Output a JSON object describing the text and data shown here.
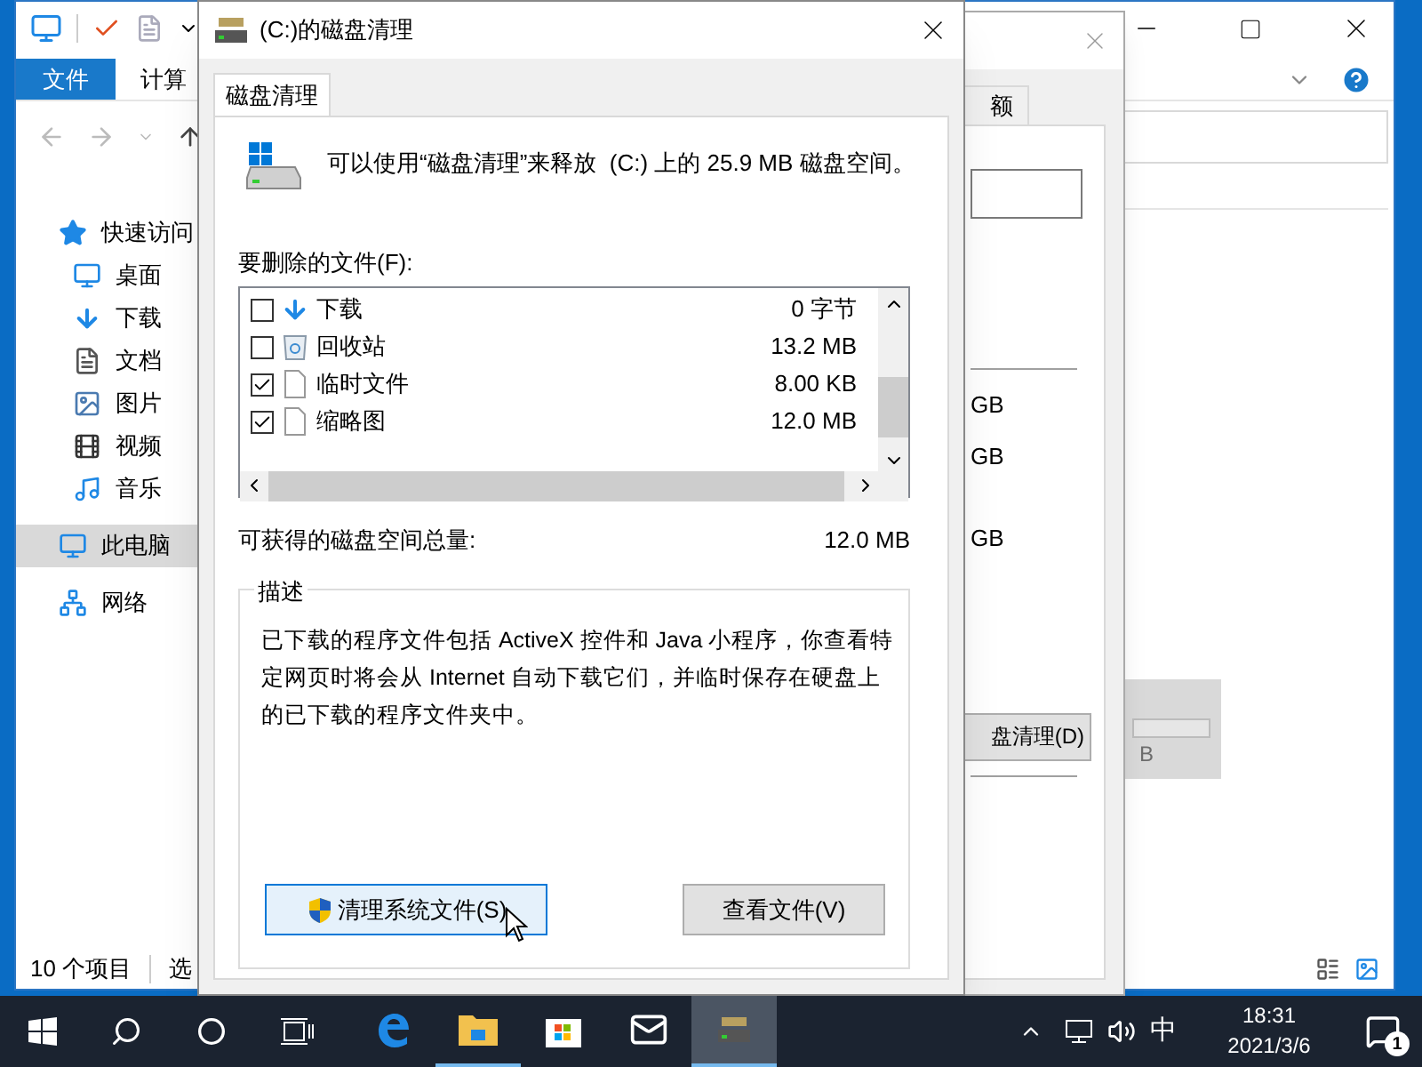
{
  "explorer": {
    "ribbon_tabs": [
      {
        "label": "文件",
        "selected": true
      },
      {
        "label": "计算",
        "selected": false
      }
    ],
    "sidebar": {
      "items": [
        {
          "label": "快速访问",
          "selected": false,
          "children": [
            {
              "label": "桌面",
              "selected": false
            },
            {
              "label": "下载",
              "selected": false
            },
            {
              "label": "文档",
              "selected": false
            },
            {
              "label": "图片",
              "selected": false
            },
            {
              "label": "视频",
              "selected": false
            },
            {
              "label": "音乐",
              "selected": false
            }
          ]
        },
        {
          "label": "此电脑",
          "selected": true
        },
        {
          "label": "网络",
          "selected": false
        }
      ]
    },
    "status_bar": {
      "item_count": "10 个项目",
      "selection": "选"
    }
  },
  "properties_dialog": {
    "tab": "额",
    "sizes": [
      "GB",
      "GB",
      "GB"
    ],
    "button": "盘清理(D)",
    "drive_size": "B"
  },
  "cleanup_dialog": {
    "title": "(C:)的磁盘清理",
    "tabs": [
      {
        "label": "磁盘清理",
        "selected": true
      }
    ],
    "intro": "可以使用“磁盘清理”来释放  (C:) 上的 25.9 MB 磁盘空间。",
    "files_label": "要删除的文件(F):",
    "files": [
      {
        "checked": false,
        "label": "下载",
        "size": "0 字节"
      },
      {
        "checked": false,
        "label": "回收站",
        "size": "13.2 MB"
      },
      {
        "checked": true,
        "label": "临时文件",
        "size": "8.00 KB"
      },
      {
        "checked": true,
        "label": "缩略图",
        "size": "12.0 MB"
      }
    ],
    "total_label": "可获得的磁盘空间总量:",
    "total": "12.0 MB",
    "description_title": "描述",
    "description": "已下载的程序文件包括 ActiveX 控件和 Java 小程序，你查看特定网页时将会从 Internet 自动下载它们，并临时保存在硬盘上的已下载的程序文件夹中。",
    "buttons": [
      {
        "label": "清理系统文件(S)",
        "kind": "shield",
        "focused": true
      },
      {
        "label": "查看文件(V)",
        "kind": "plain",
        "focused": false
      }
    ]
  },
  "taskbar": {
    "apps": [
      {
        "running": false,
        "selected": false
      },
      {
        "running": true,
        "selected": false
      },
      {
        "running": false,
        "selected": false
      },
      {
        "running": false,
        "selected": false
      },
      {
        "running": true,
        "selected": true
      }
    ],
    "ime": "中",
    "time": "18:31",
    "date": "2021/3/6",
    "notification_count": "1"
  }
}
